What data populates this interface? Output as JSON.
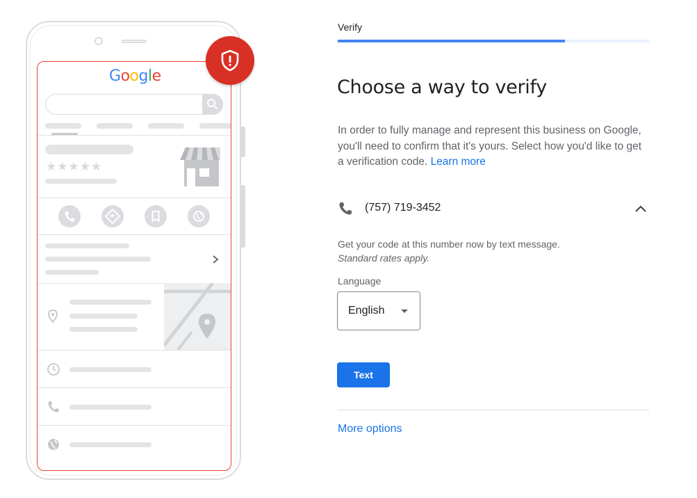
{
  "illustration": {
    "logo_text": "Google",
    "logo_colors": [
      "#4285f4",
      "#ea4335",
      "#fbbc05",
      "#4285f4",
      "#34a853",
      "#ea4335"
    ],
    "badge_color": "#d93025",
    "badge_icon": "shield-alert-icon",
    "rating_stars": "★★★★★"
  },
  "verify": {
    "step_label": "Verify",
    "progress": 0.73,
    "title": "Choose a way to verify",
    "description": "In order to fully manage and represent this business on Google, you'll need to confirm that it's yours. Select how you'd like to get a verification code.",
    "learn_more": "Learn more",
    "phone_number": "(757) 719-3452",
    "hint_line1": "Get your code at this number now by text message.",
    "hint_line2": "Standard rates apply.",
    "language_label": "Language",
    "language_value": "English",
    "text_button": "Text",
    "more_options": "More options"
  },
  "colors": {
    "accent": "#1a73e8",
    "progress": "#4285f4",
    "alert": "#d93025"
  }
}
